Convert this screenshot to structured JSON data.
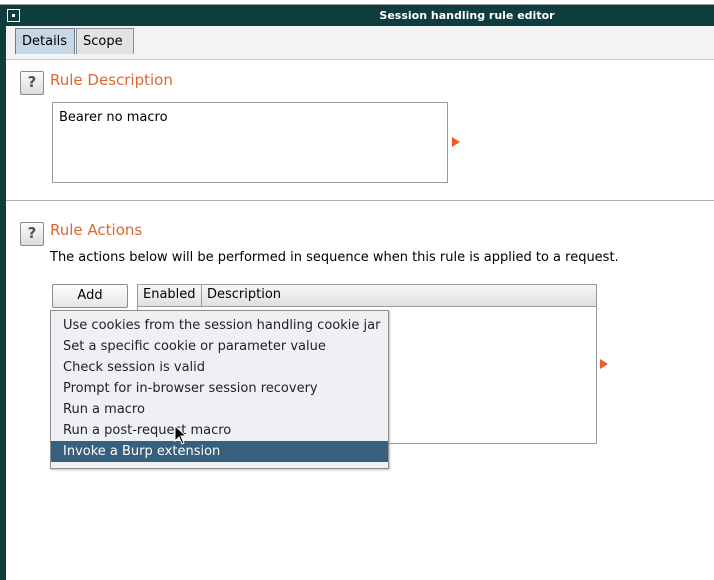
{
  "window": {
    "title": "Session handling rule editor"
  },
  "tabs": [
    {
      "label": "Details",
      "active": true
    },
    {
      "label": "Scope",
      "active": false
    }
  ],
  "rule_description": {
    "heading": "Rule Description",
    "help_glyph": "?",
    "value": "Bearer no macro"
  },
  "rule_actions": {
    "heading": "Rule Actions",
    "help_glyph": "?",
    "hint": "The actions below will be performed in sequence when this rule is applied to a request.",
    "add_label": "Add",
    "table_columns": [
      "Enabled",
      "Description"
    ],
    "menu_items": [
      "Use cookies from the session handling cookie jar",
      "Set a specific cookie or parameter value",
      "Check session is valid",
      "Prompt for in-browser session recovery",
      "Run a macro",
      "Run a post-request macro",
      "Invoke a Burp extension"
    ],
    "selected_index": 6
  },
  "colors": {
    "titlebar": "#0f3d3d",
    "accent": "#e1662f",
    "selection": "#37607f",
    "arrow": "#f05a28"
  },
  "icons": {
    "window": "window-menu-icon",
    "help": "help-icon",
    "expand": "triangle-right-icon",
    "cursor": "mouse-pointer-icon"
  }
}
